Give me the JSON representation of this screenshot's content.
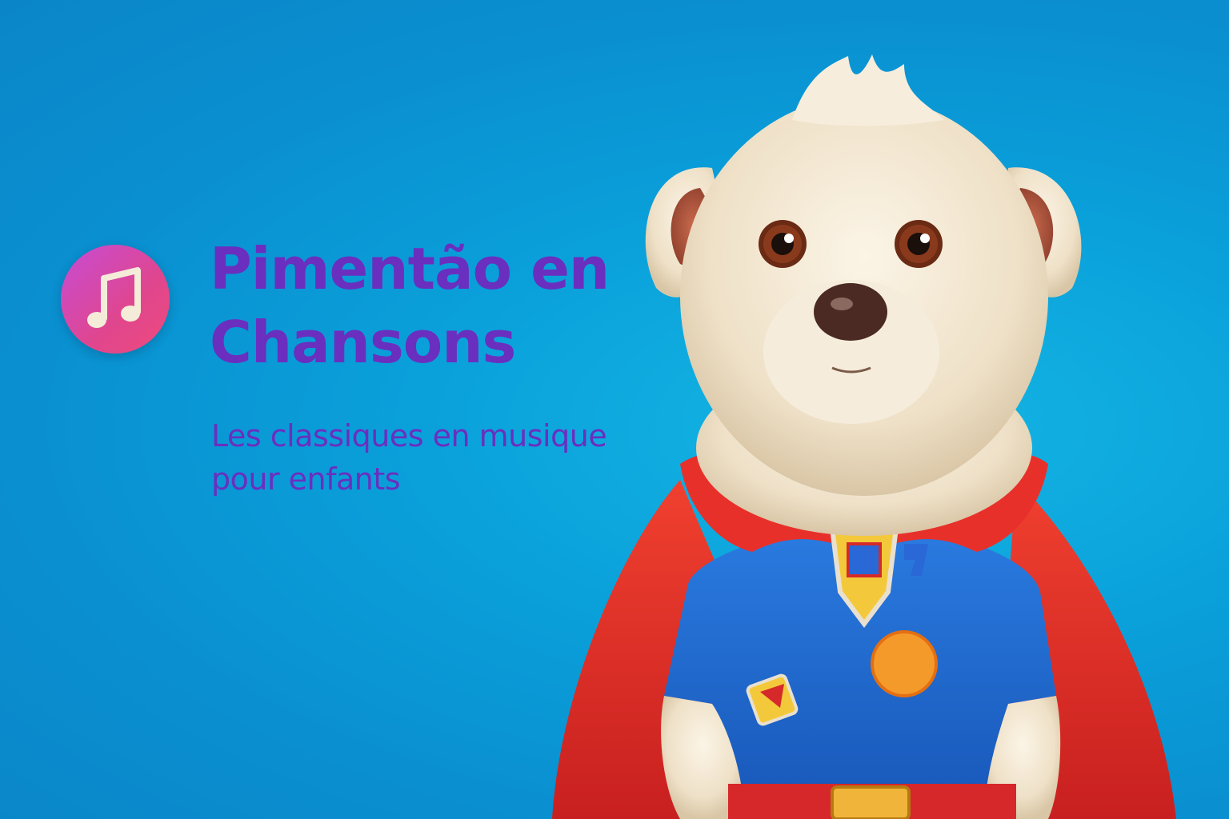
{
  "brand": {
    "icon": "music-note-icon",
    "title": "Pimentão en Chansons",
    "subtitle": "Les classiques en musique pour enfants"
  },
  "mascot": {
    "description_icon": "superhero-dog-illustration"
  },
  "colors": {
    "background": "#0a9ad6",
    "title_text": "#6a2fbf",
    "icon_gradient_start": "#c64cd6",
    "icon_gradient_end": "#ee4b7c",
    "cape": "#e8302a",
    "shirt": "#1f6fd1",
    "fur": "#f2e6d2"
  }
}
